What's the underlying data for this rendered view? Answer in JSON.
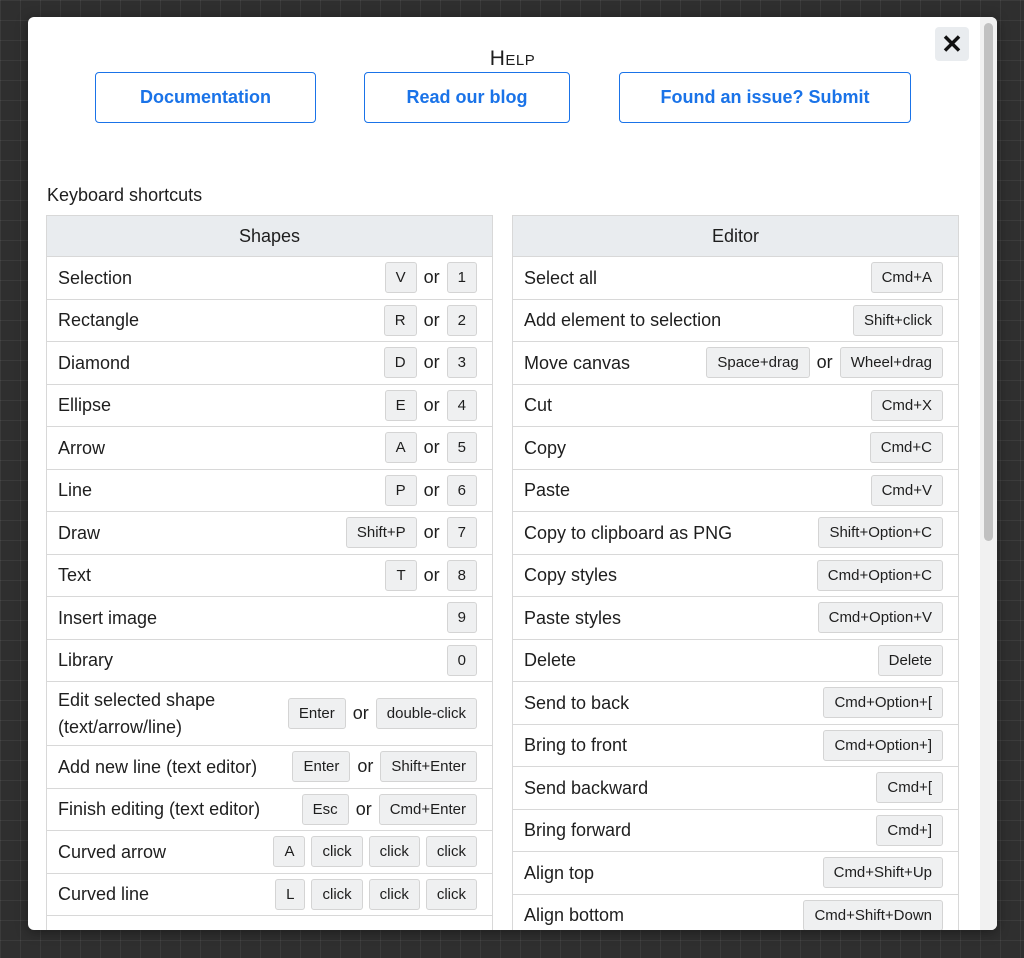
{
  "dialog": {
    "title": "Help",
    "close_icon": "close-icon"
  },
  "links": [
    {
      "label": "Documentation"
    },
    {
      "label": "Read our blog"
    },
    {
      "label": "Found an issue? Submit"
    }
  ],
  "section_title": "Keyboard shortcuts",
  "separator": "or",
  "shapes": {
    "header": "Shapes",
    "rows": [
      {
        "label": "Selection",
        "keys": [
          [
            "V"
          ],
          [
            "1"
          ]
        ]
      },
      {
        "label": "Rectangle",
        "keys": [
          [
            "R"
          ],
          [
            "2"
          ]
        ]
      },
      {
        "label": "Diamond",
        "keys": [
          [
            "D"
          ],
          [
            "3"
          ]
        ]
      },
      {
        "label": "Ellipse",
        "keys": [
          [
            "E"
          ],
          [
            "4"
          ]
        ]
      },
      {
        "label": "Arrow",
        "keys": [
          [
            "A"
          ],
          [
            "5"
          ]
        ]
      },
      {
        "label": "Line",
        "keys": [
          [
            "P"
          ],
          [
            "6"
          ]
        ]
      },
      {
        "label": "Draw",
        "keys": [
          [
            "Shift+P"
          ],
          [
            "7"
          ]
        ]
      },
      {
        "label": "Text",
        "keys": [
          [
            "T"
          ],
          [
            "8"
          ]
        ]
      },
      {
        "label": "Insert image",
        "keys": [
          [
            "9"
          ]
        ]
      },
      {
        "label": "Library",
        "keys": [
          [
            "0"
          ]
        ]
      },
      {
        "label": "Edit selected shape (text/arrow/line)",
        "keys": [
          [
            "Enter"
          ],
          [
            "double-click"
          ]
        ],
        "tall": true
      },
      {
        "label": "Add new line (text editor)",
        "keys": [
          [
            "Enter"
          ],
          [
            "Shift+Enter"
          ]
        ]
      },
      {
        "label": "Finish editing (text editor)",
        "keys": [
          [
            "Esc"
          ],
          [
            "Cmd+Enter"
          ]
        ]
      },
      {
        "label": "Curved arrow",
        "keys": [
          [
            "A",
            "click",
            "click",
            "click"
          ]
        ]
      },
      {
        "label": "Curved line",
        "keys": [
          [
            "L",
            "click",
            "click",
            "click"
          ]
        ]
      },
      {
        "label": "",
        "keys": []
      }
    ]
  },
  "editor": {
    "header": "Editor",
    "rows": [
      {
        "label": "Select all",
        "keys": [
          [
            "Cmd+A"
          ]
        ]
      },
      {
        "label": "Add element to selection",
        "keys": [
          [
            "Shift+click"
          ]
        ]
      },
      {
        "label": "Move canvas",
        "keys": [
          [
            "Space+drag"
          ],
          [
            "Wheel+drag"
          ]
        ]
      },
      {
        "label": "Cut",
        "keys": [
          [
            "Cmd+X"
          ]
        ]
      },
      {
        "label": "Copy",
        "keys": [
          [
            "Cmd+C"
          ]
        ]
      },
      {
        "label": "Paste",
        "keys": [
          [
            "Cmd+V"
          ]
        ]
      },
      {
        "label": "Copy to clipboard as PNG",
        "keys": [
          [
            "Shift+Option+C"
          ]
        ]
      },
      {
        "label": "Copy styles",
        "keys": [
          [
            "Cmd+Option+C"
          ]
        ]
      },
      {
        "label": "Paste styles",
        "keys": [
          [
            "Cmd+Option+V"
          ]
        ]
      },
      {
        "label": "Delete",
        "keys": [
          [
            "Delete"
          ]
        ]
      },
      {
        "label": "Send to back",
        "keys": [
          [
            "Cmd+Option+["
          ]
        ]
      },
      {
        "label": "Bring to front",
        "keys": [
          [
            "Cmd+Option+]"
          ]
        ]
      },
      {
        "label": "Send backward",
        "keys": [
          [
            "Cmd+["
          ]
        ]
      },
      {
        "label": "Bring forward",
        "keys": [
          [
            "Cmd+]"
          ]
        ]
      },
      {
        "label": "Align top",
        "keys": [
          [
            "Cmd+Shift+Up"
          ]
        ]
      },
      {
        "label": "Align bottom",
        "keys": [
          [
            "Cmd+Shift+Down"
          ]
        ]
      }
    ]
  }
}
